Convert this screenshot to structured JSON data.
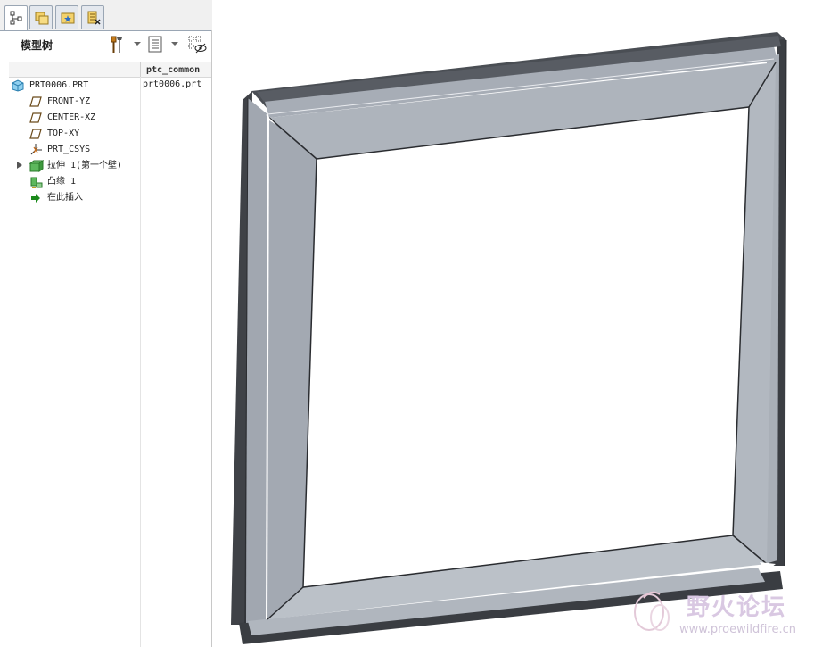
{
  "panel": {
    "title": "模型树",
    "tabs": [
      {
        "name": "model-tree-tab",
        "active": true
      },
      {
        "name": "folder-browser-tab",
        "active": false
      },
      {
        "name": "favorites-tab",
        "active": false
      },
      {
        "name": "connections-tab",
        "active": false
      }
    ]
  },
  "columns": {
    "col2_header": "ptc_common"
  },
  "tree": {
    "items": [
      {
        "label": "PRT0006.PRT",
        "icon": "part-icon",
        "col2": "prt0006.prt"
      },
      {
        "label": "FRONT-YZ",
        "icon": "datum-plane-icon"
      },
      {
        "label": "CENTER-XZ",
        "icon": "datum-plane-icon"
      },
      {
        "label": "TOP-XY",
        "icon": "datum-plane-icon"
      },
      {
        "label": "PRT_CSYS",
        "icon": "csys-icon"
      },
      {
        "label": "拉伸 1(第一个壁)",
        "icon": "extrude-wall-icon"
      },
      {
        "label": "凸缘 1",
        "icon": "flange-icon"
      },
      {
        "label": "在此插入",
        "icon": "insert-here-icon"
      }
    ]
  },
  "watermark": {
    "title": "野火论坛",
    "url": "www.proewildfire.cn"
  },
  "colors": {
    "part_face": "#a7adb6",
    "part_face_light": "#b8bec6",
    "part_edge_dark": "#3f4247",
    "tab_border": "#9aa6b4",
    "insert_arrow": "#1a8a1a"
  }
}
